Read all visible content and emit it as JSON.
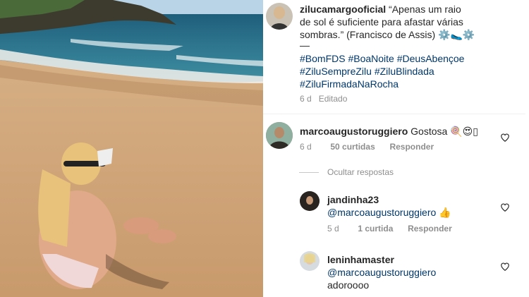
{
  "caption": {
    "username": "zilucamargooficial",
    "line1": "“Apenas um raio",
    "line2": "de sol é suficiente para afastar várias",
    "line3": "sombras.” (Francisco de Assis) ⚙️🥿⚙️",
    "dash": "—",
    "hashtags_line1": "#BomFDS #BoaNoite #DeusAbençoe",
    "hashtags_line2": "#ZiluSempreZilu #ZiluBlindada",
    "hashtags_line3": "#ZiluFirmadaNaRocha",
    "time": "6 d",
    "edited": "Editado"
  },
  "comment1": {
    "username": "marcoaugustoruggiero",
    "text": "Gostosa 🍭😍▯",
    "time": "6 d",
    "likes": "50 curtidas",
    "reply": "Responder"
  },
  "hide_replies": "Ocultar respostas",
  "reply1": {
    "username": "jandinha23",
    "mention": "@marcoaugustoruggiero",
    "text": "👍",
    "time": "5 d",
    "likes": "1 curtida",
    "reply": "Responder"
  },
  "reply2": {
    "username": "leninhamaster",
    "mention": "@marcoaugustoruggiero",
    "text": "adoroooo"
  },
  "colors": {
    "hashtag": "#00376b",
    "meta": "#8e8e8e",
    "text": "#262626"
  },
  "icons": [
    "heart-icon",
    "avatar"
  ]
}
